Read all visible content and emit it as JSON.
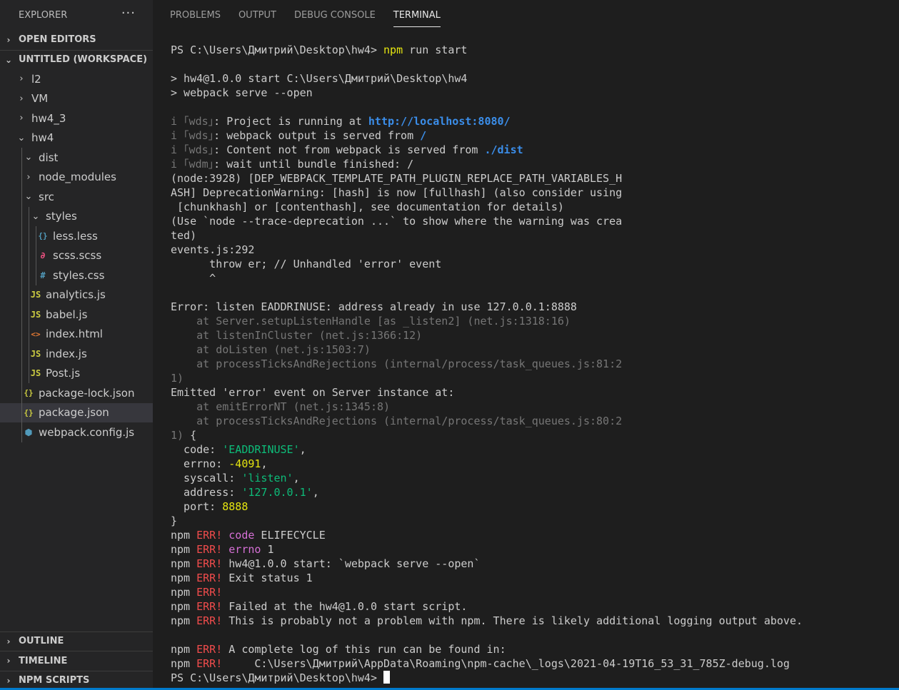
{
  "sidebar": {
    "explorer_title": "EXPLORER",
    "more_actions": "···",
    "open_editors": "OPEN EDITORS",
    "workspace": "UNTITLED (WORKSPACE)",
    "tree": [
      {
        "label": "l2",
        "depth": 0,
        "kind": "folder-closed",
        "icon": "chevron-right-icon"
      },
      {
        "label": "VM",
        "depth": 0,
        "kind": "folder-closed",
        "icon": "chevron-right-icon"
      },
      {
        "label": "hw4_3",
        "depth": 0,
        "kind": "folder-closed",
        "icon": "chevron-right-icon"
      },
      {
        "label": "hw4",
        "depth": 0,
        "kind": "folder-open",
        "icon": "chevron-down-icon"
      },
      {
        "label": "dist",
        "depth": 1,
        "kind": "folder-open",
        "icon": "chevron-down-icon"
      },
      {
        "label": "node_modules",
        "depth": 1,
        "kind": "folder-closed",
        "icon": "chevron-right-icon"
      },
      {
        "label": "src",
        "depth": 1,
        "kind": "folder-open",
        "icon": "chevron-down-icon"
      },
      {
        "label": "styles",
        "depth": 2,
        "kind": "folder-open",
        "icon": "chevron-down-icon"
      },
      {
        "label": "less.less",
        "depth": 3,
        "kind": "file",
        "glyph": "{}",
        "color": "#519aba",
        "icon": "less-file-icon"
      },
      {
        "label": "scss.scss",
        "depth": 3,
        "kind": "file",
        "glyph": "∂",
        "color": "#f55385",
        "icon": "sass-file-icon"
      },
      {
        "label": "styles.css",
        "depth": 3,
        "kind": "file",
        "glyph": "#",
        "color": "#519aba",
        "icon": "css-file-icon"
      },
      {
        "label": "analytics.js",
        "depth": 2,
        "kind": "file",
        "glyph": "JS",
        "color": "#cbcb41",
        "icon": "js-file-icon"
      },
      {
        "label": "babel.js",
        "depth": 2,
        "kind": "file",
        "glyph": "JS",
        "color": "#cbcb41",
        "icon": "js-file-icon"
      },
      {
        "label": "index.html",
        "depth": 2,
        "kind": "file",
        "glyph": "<>",
        "color": "#e37933",
        "icon": "html-file-icon"
      },
      {
        "label": "index.js",
        "depth": 2,
        "kind": "file",
        "glyph": "JS",
        "color": "#cbcb41",
        "icon": "js-file-icon"
      },
      {
        "label": "Post.js",
        "depth": 2,
        "kind": "file",
        "glyph": "JS",
        "color": "#cbcb41",
        "icon": "js-file-icon"
      },
      {
        "label": "package-lock.json",
        "depth": 1,
        "kind": "file",
        "glyph": "{}",
        "color": "#cbcb41",
        "icon": "json-file-icon"
      },
      {
        "label": "package.json",
        "depth": 1,
        "kind": "file",
        "glyph": "{}",
        "color": "#cbcb41",
        "icon": "json-file-icon",
        "selected": true
      },
      {
        "label": "webpack.config.js",
        "depth": 1,
        "kind": "file",
        "glyph": "⬢",
        "color": "#519aba",
        "icon": "webpack-file-icon"
      }
    ],
    "bottom_sections": [
      "OUTLINE",
      "TIMELINE",
      "NPM SCRIPTS"
    ]
  },
  "panel": {
    "tabs": [
      {
        "label": "PROBLEMS",
        "active": false
      },
      {
        "label": "OUTPUT",
        "active": false
      },
      {
        "label": "DEBUG CONSOLE",
        "active": false
      },
      {
        "label": "TERMINAL",
        "active": true
      }
    ]
  },
  "colors": {
    "dim": "#767676",
    "yellow": "#e5e510",
    "blue": "#3b8eea",
    "green": "#0dbc79",
    "red": "#f14c4c",
    "magenta": "#d670d6",
    "cyan": "#11a8cd",
    "accent": "#007acc"
  },
  "terminal": {
    "lines": [
      [
        {
          "t": "PS C:\\Users\\Дмитрий\\Desktop\\hw4> "
        },
        {
          "t": "npm",
          "c": "yellow"
        },
        {
          "t": " run start"
        }
      ],
      [],
      [
        {
          "t": "> hw4@1.0.0 start C:\\Users\\Дмитрий\\Desktop\\hw4"
        }
      ],
      [
        {
          "t": "> webpack serve --open"
        }
      ],
      [],
      [
        {
          "t": "i ｢wds｣",
          "c": "dim"
        },
        {
          "t": ": Project is running at "
        },
        {
          "t": "http://localhost:8080/",
          "c": "blue"
        }
      ],
      [
        {
          "t": "i ｢wds｣",
          "c": "dim"
        },
        {
          "t": ": webpack output is served from "
        },
        {
          "t": "/",
          "c": "blue"
        }
      ],
      [
        {
          "t": "i ｢wds｣",
          "c": "dim"
        },
        {
          "t": ": Content not from webpack is served from "
        },
        {
          "t": "./dist",
          "c": "blue"
        }
      ],
      [
        {
          "t": "i ｢wdm｣",
          "c": "dim"
        },
        {
          "t": ": wait until bundle finished: /"
        }
      ],
      [
        {
          "t": "(node:3928) [DEP_WEBPACK_TEMPLATE_PATH_PLUGIN_REPLACE_PATH_VARIABLES_H"
        }
      ],
      [
        {
          "t": "ASH] DeprecationWarning: [hash] is now [fullhash] (also consider using"
        }
      ],
      [
        {
          "t": " [chunkhash] or [contenthash], see documentation for details)"
        }
      ],
      [
        {
          "t": "(Use `node --trace-deprecation ...` to show where the warning was crea"
        }
      ],
      [
        {
          "t": "ted)"
        }
      ],
      [
        {
          "t": "events.js:292"
        }
      ],
      [
        {
          "t": "      throw er; // Unhandled 'error' event"
        }
      ],
      [
        {
          "t": "      ^"
        }
      ],
      [],
      [
        {
          "t": "Error: listen EADDRINUSE: address already in use 127.0.0.1:8888"
        }
      ],
      [
        {
          "t": "    at Server.setupListenHandle [as _listen2] (net.js:1318:16)",
          "c": "dim"
        }
      ],
      [
        {
          "t": "    at listenInCluster (net.js:1366:12)",
          "c": "dim"
        }
      ],
      [
        {
          "t": "    at doListen (net.js:1503:7)",
          "c": "dim"
        }
      ],
      [
        {
          "t": "    at processTicksAndRejections (internal/process/task_queues.js:81:2",
          "c": "dim"
        }
      ],
      [
        {
          "t": "1)",
          "c": "dim"
        }
      ],
      [
        {
          "t": "Emitted 'error' event on Server instance at:"
        }
      ],
      [
        {
          "t": "    at emitErrorNT (net.js:1345:8)",
          "c": "dim"
        }
      ],
      [
        {
          "t": "    at processTicksAndRejections (internal/process/task_queues.js:80:2",
          "c": "dim"
        }
      ],
      [
        {
          "t": "1)",
          "c": "dim"
        },
        {
          "t": " {"
        }
      ],
      [
        {
          "t": "  code: "
        },
        {
          "t": "'EADDRINUSE'",
          "c": "green"
        },
        {
          "t": ","
        }
      ],
      [
        {
          "t": "  errno: "
        },
        {
          "t": "-4091",
          "c": "yellow"
        },
        {
          "t": ","
        }
      ],
      [
        {
          "t": "  syscall: "
        },
        {
          "t": "'listen'",
          "c": "green"
        },
        {
          "t": ","
        }
      ],
      [
        {
          "t": "  address: "
        },
        {
          "t": "'127.0.0.1'",
          "c": "green"
        },
        {
          "t": ","
        }
      ],
      [
        {
          "t": "  port: "
        },
        {
          "t": "8888",
          "c": "yellow"
        }
      ],
      [
        {
          "t": "}"
        }
      ],
      [
        {
          "t": "npm "
        },
        {
          "t": "ERR!",
          "c": "red"
        },
        {
          "t": " "
        },
        {
          "t": "code",
          "c": "magenta"
        },
        {
          "t": " ELIFECYCLE"
        }
      ],
      [
        {
          "t": "npm "
        },
        {
          "t": "ERR!",
          "c": "red"
        },
        {
          "t": " "
        },
        {
          "t": "errno",
          "c": "magenta"
        },
        {
          "t": " 1"
        }
      ],
      [
        {
          "t": "npm "
        },
        {
          "t": "ERR!",
          "c": "red"
        },
        {
          "t": " hw4@1.0.0 start: `webpack serve --open`"
        }
      ],
      [
        {
          "t": "npm "
        },
        {
          "t": "ERR!",
          "c": "red"
        },
        {
          "t": " Exit status 1"
        }
      ],
      [
        {
          "t": "npm "
        },
        {
          "t": "ERR!",
          "c": "red"
        }
      ],
      [
        {
          "t": "npm "
        },
        {
          "t": "ERR!",
          "c": "red"
        },
        {
          "t": " Failed at the hw4@1.0.0 start script."
        }
      ],
      [
        {
          "t": "npm "
        },
        {
          "t": "ERR!",
          "c": "red"
        },
        {
          "t": " This is probably not a problem with npm. There is likely additional logging output above."
        }
      ],
      [],
      [
        {
          "t": "npm "
        },
        {
          "t": "ERR!",
          "c": "red"
        },
        {
          "t": " A complete log of this run can be found in:"
        }
      ],
      [
        {
          "t": "npm "
        },
        {
          "t": "ERR!",
          "c": "red"
        },
        {
          "t": "     C:\\Users\\Дмитрий\\AppData\\Roaming\\npm-cache\\_logs\\2021-04-19T16_53_31_785Z-debug.log"
        }
      ],
      [
        {
          "t": "PS C:\\Users\\Дмитрий\\Desktop\\hw4> "
        }
      ]
    ]
  }
}
